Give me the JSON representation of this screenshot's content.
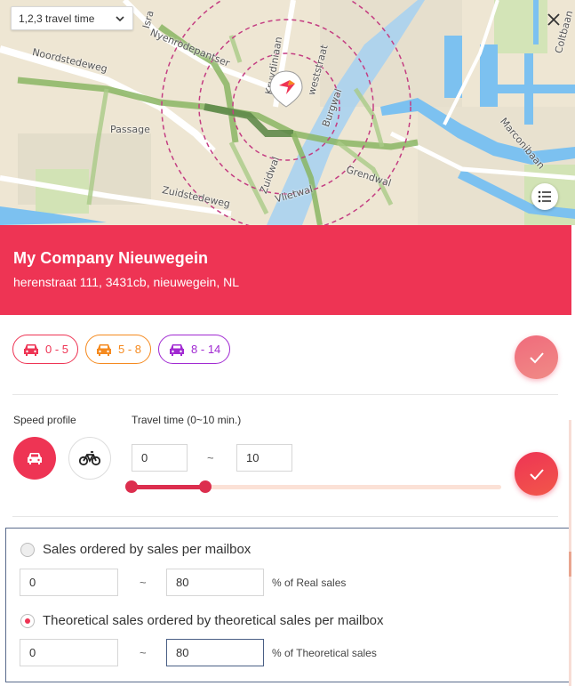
{
  "map": {
    "travel_select": "1,2,3 travel time",
    "labels": {
      "noordstedeweg": "Noordstedeweg",
      "passage": "Passage",
      "nyenrodepantser": "Nyenrodepantser",
      "zuidstedeweg": "Zuidstedeweg",
      "vlietwal": "Vlietwal",
      "grendwal": "Grendwal",
      "burgwal": "Burgwal",
      "zuidwal": "Zuidwal",
      "weststraat": "weststraat",
      "kruydiniaan": "Kruydiniaan",
      "isra": "Isra",
      "marconibaan": "Marconibaan",
      "coltbaan": "Coltbaan"
    }
  },
  "company": {
    "name": "My Company Nieuwegein",
    "address": "herenstraat 111, 3431cb, nieuwegein, NL"
  },
  "legend": [
    {
      "label": "0 - 5",
      "color": "#ee3454"
    },
    {
      "label": "5 - 8",
      "color": "#f58a1f"
    },
    {
      "label": "8 - 14",
      "color": "#a12ad2"
    }
  ],
  "speed": {
    "label": "Speed profile",
    "active_mode": "car",
    "modes": [
      "car",
      "bike"
    ]
  },
  "travel_time": {
    "label": "Travel time (0~10 min.)",
    "min": "0",
    "max": "10",
    "separator": "~",
    "range_fraction": [
      0.0,
      0.2
    ]
  },
  "sales": {
    "option1": {
      "label": "Sales ordered by sales per mailbox",
      "min": "0",
      "max": "80",
      "unit": "% of Real sales",
      "checked": false
    },
    "option2": {
      "label": "Theoretical sales ordered by theoretical sales per mailbox",
      "min": "0",
      "max": "80",
      "unit": "% of Theoretical sales",
      "checked": true
    },
    "separator": "~"
  },
  "colors": {
    "brand": "#ee3454",
    "orange": "#f58a1f",
    "purple": "#a12ad2"
  }
}
